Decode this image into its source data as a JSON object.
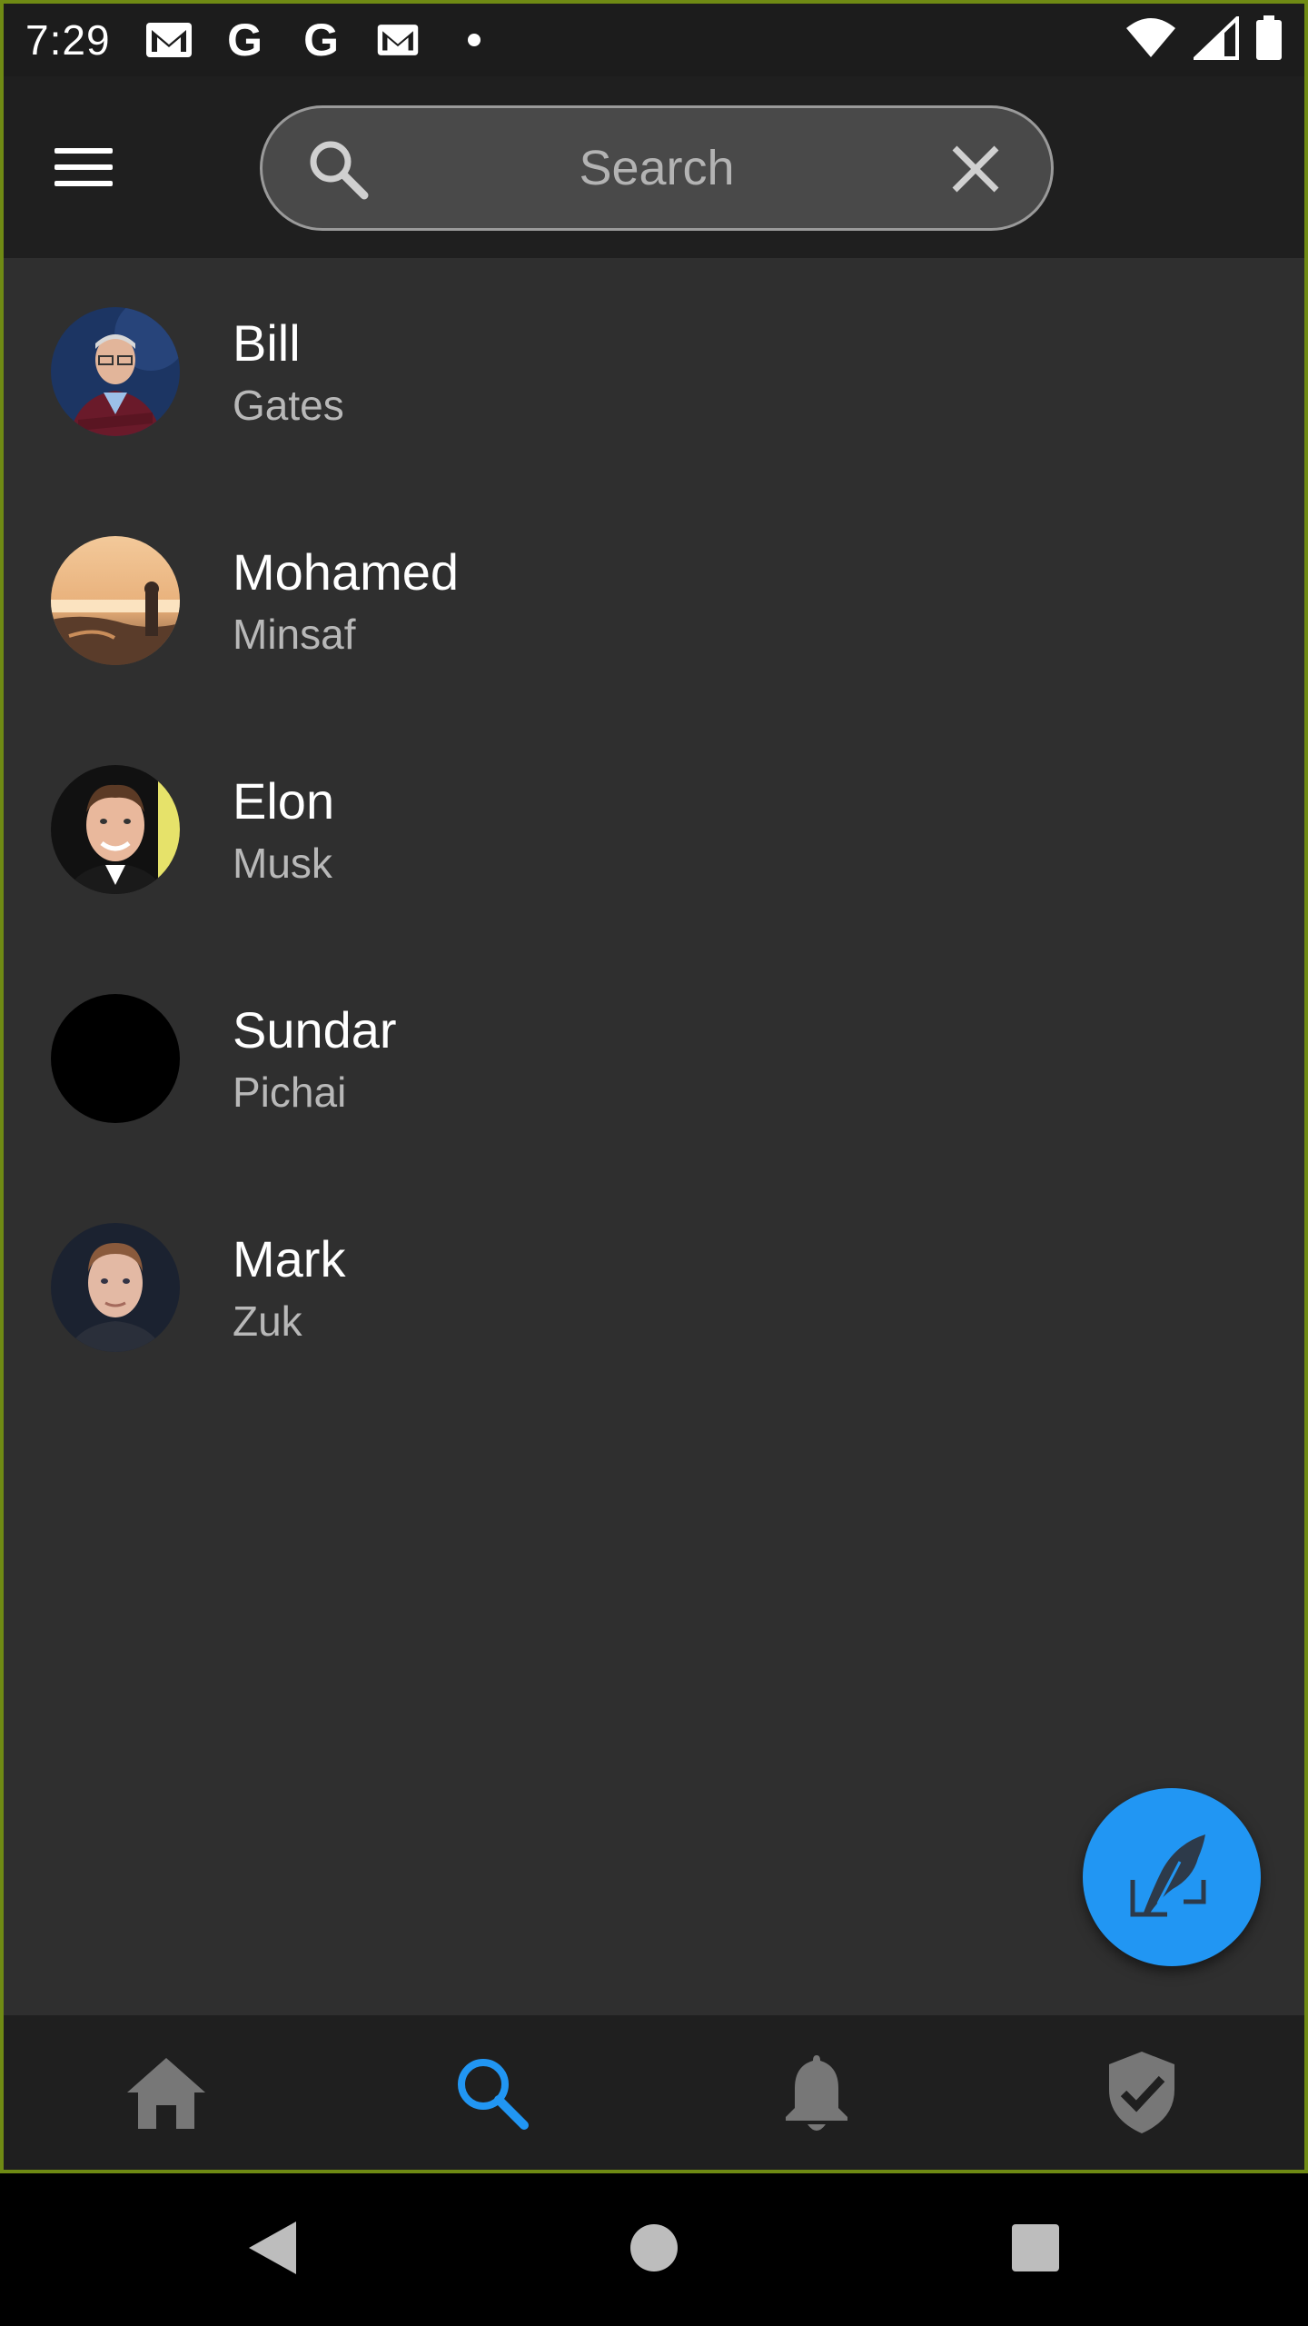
{
  "status_bar": {
    "time": "7:29",
    "notification_icons": [
      "gmail-icon",
      "google-icon",
      "google-icon",
      "gmail-icon",
      "dot-icon"
    ],
    "system_icons": [
      "wifi-icon",
      "signal-icon",
      "battery-icon"
    ]
  },
  "app_bar": {
    "menu_icon": "hamburger-icon",
    "search": {
      "placeholder": "Search",
      "value": ""
    },
    "clear_icon": "close-icon"
  },
  "contacts": [
    {
      "first": "Bill",
      "last": "Gates",
      "avatar": "photo"
    },
    {
      "first": "Mohamed",
      "last": "Minsaf",
      "avatar": "photo"
    },
    {
      "first": "Elon",
      "last": "Musk",
      "avatar": "photo"
    },
    {
      "first": "Sundar",
      "last": "Pichai",
      "avatar": "empty"
    },
    {
      "first": "Mark",
      "last": "Zuk",
      "avatar": "photo"
    }
  ],
  "fab": {
    "icon": "feather-compose-icon"
  },
  "bottom_nav": {
    "items": [
      {
        "name": "home",
        "icon": "home-icon",
        "active": false
      },
      {
        "name": "search",
        "icon": "search-icon",
        "active": true
      },
      {
        "name": "notifications",
        "icon": "bell-icon",
        "active": false
      },
      {
        "name": "security",
        "icon": "shield-check-icon",
        "active": false
      }
    ]
  },
  "colors": {
    "accent": "#2196f3",
    "background": "#2f2f2f",
    "bar": "#1f1f1f",
    "inactive_icon": "#777777",
    "frame_border": "#6f8a14"
  }
}
